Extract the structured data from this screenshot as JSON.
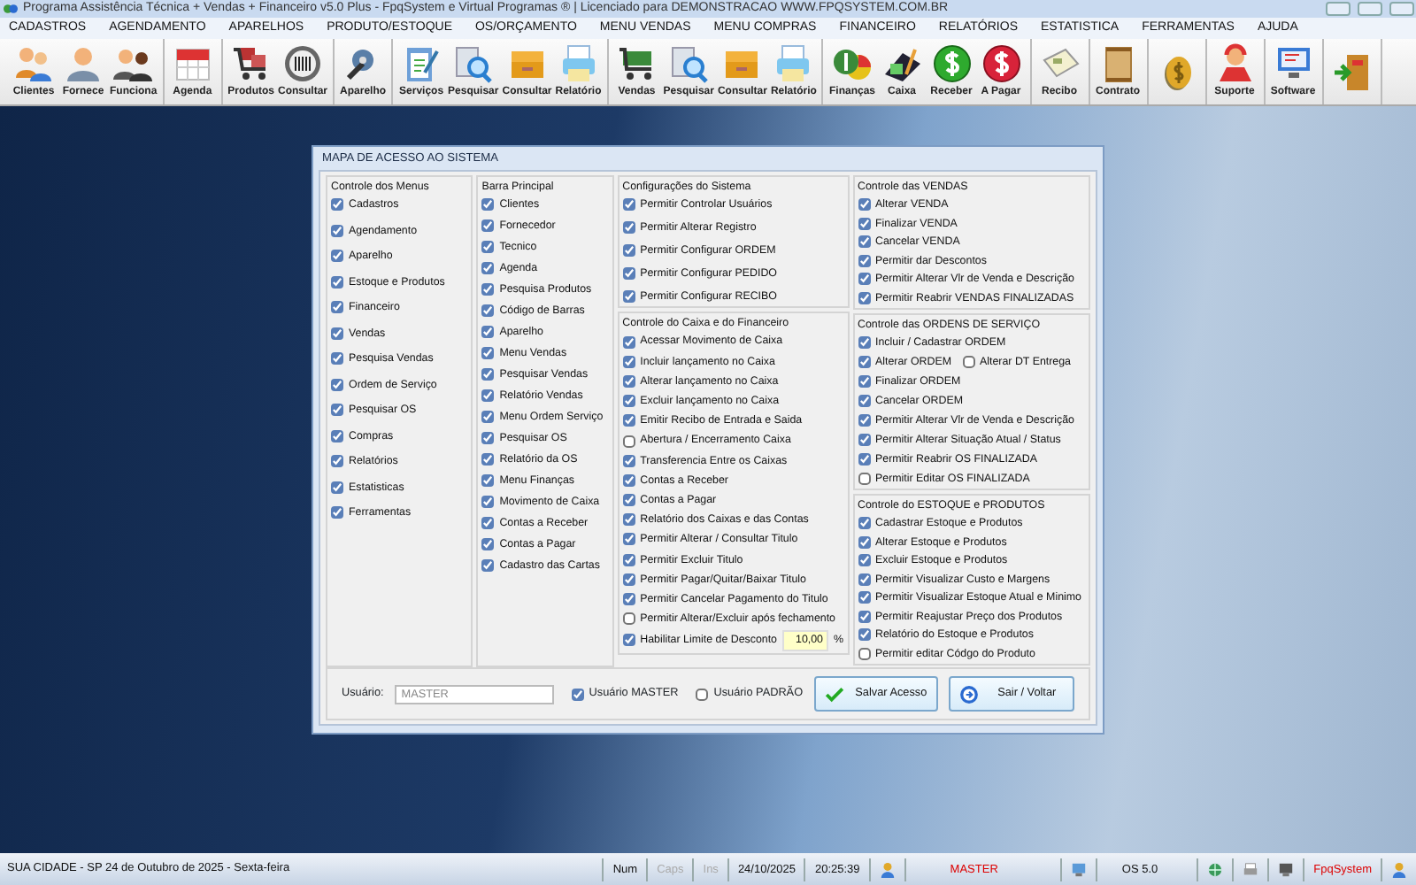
{
  "window": {
    "title": "Programa Assistência Técnica + Vendas + Financeiro v5.0 Plus - FpqSystem e Virtual Programas ® | Licenciado para  DEMONSTRACAO WWW.FPQSYSTEM.COM.BR"
  },
  "menu": [
    "CADASTROS",
    "AGENDAMENTO",
    "APARELHOS",
    "PRODUTO/ESTOQUE",
    "OS/ORÇAMENTO",
    "MENU VENDAS",
    "MENU COMPRAS",
    "FINANCEIRO",
    "RELATÓRIOS",
    "ESTATISTICA",
    "FERRAMENTAS",
    "AJUDA"
  ],
  "toolbar": [
    {
      "kind": "labeled",
      "labels": [
        "Clientes",
        "Fornece",
        "Funciona"
      ]
    },
    {
      "kind": "labeled",
      "labels": [
        "Agenda"
      ]
    },
    {
      "kind": "labeled",
      "labels": [
        "Produtos",
        "Consultar"
      ]
    },
    {
      "kind": "labeled",
      "labels": [
        "Aparelho"
      ]
    },
    {
      "kind": "labeled",
      "labels": [
        "Serviços",
        "Pesquisar",
        "Consultar",
        "Relatório"
      ]
    },
    {
      "kind": "labeled",
      "labels": [
        "Vendas",
        "Pesquisar",
        "Consultar",
        "Relatório"
      ]
    },
    {
      "kind": "labeled",
      "labels": [
        "Finanças",
        "Caixa",
        "Receber",
        "A Pagar"
      ]
    },
    {
      "kind": "labeled",
      "labels": [
        "Recibo"
      ]
    },
    {
      "kind": "labeled",
      "labels": [
        "Contrato"
      ]
    },
    {
      "kind": "icon"
    },
    {
      "kind": "labeled",
      "labels": [
        "Suporte"
      ]
    },
    {
      "kind": "labeled",
      "labels": [
        "Software"
      ]
    },
    {
      "kind": "icon"
    }
  ],
  "dialog": {
    "title": "MAPA DE ACESSO AO SISTEMA",
    "columns": [
      [
        {
          "title": "Controle dos Menus",
          "items": [
            {
              "label": "Cadastros",
              "checked": true
            },
            {
              "label": "Agendamento",
              "checked": true
            },
            {
              "label": "Aparelho",
              "checked": true
            },
            {
              "label": "Estoque e Produtos",
              "checked": true
            },
            {
              "label": "Financeiro",
              "checked": true
            },
            {
              "label": "Vendas",
              "checked": true
            },
            {
              "label": "Pesquisa Vendas",
              "checked": true
            },
            {
              "label": "Ordem de Serviço",
              "checked": true
            },
            {
              "label": "Pesquisar OS",
              "checked": true
            },
            {
              "label": "Compras",
              "checked": true
            },
            {
              "label": "Relatórios",
              "checked": true
            },
            {
              "label": "Estatisticas",
              "checked": true
            },
            {
              "label": "Ferramentas",
              "checked": true
            }
          ]
        }
      ],
      [
        {
          "title": "Barra Principal",
          "items": [
            {
              "label": "Clientes",
              "checked": true
            },
            {
              "label": "Fornecedor",
              "checked": true
            },
            {
              "label": "Tecnico",
              "checked": true
            },
            {
              "label": "Agenda",
              "checked": true
            },
            {
              "label": "Pesquisa Produtos",
              "checked": true
            },
            {
              "label": "Código de Barras",
              "checked": true
            },
            {
              "label": "Aparelho",
              "checked": true
            },
            {
              "label": "Menu Vendas",
              "checked": true
            },
            {
              "label": "Pesquisar Vendas",
              "checked": true
            },
            {
              "label": "Relatório Vendas",
              "checked": true
            },
            {
              "label": "Menu Ordem Serviço",
              "checked": true
            },
            {
              "label": "Pesquisar OS",
              "checked": true
            },
            {
              "label": "Relatório da OS",
              "checked": true
            },
            {
              "label": "Menu Finanças",
              "checked": true
            },
            {
              "label": "Movimento de Caixa",
              "checked": true
            },
            {
              "label": "Contas a Receber",
              "checked": true
            },
            {
              "label": "Contas a Pagar",
              "checked": true
            },
            {
              "label": "Cadastro das Cartas",
              "checked": true
            }
          ]
        }
      ],
      [
        {
          "title": "Configurações do Sistema",
          "items": [
            {
              "label": "Permitir Controlar Usuários",
              "checked": true
            },
            {
              "label": "Permitir Alterar Registro",
              "checked": true
            },
            {
              "label": "Permitir Configurar ORDEM",
              "checked": true
            },
            {
              "label": "Permitir Configurar PEDIDO",
              "checked": true
            },
            {
              "label": "Permitir Configurar RECIBO",
              "checked": true
            }
          ]
        },
        {
          "title": "Controle do Caixa e do Financeiro",
          "items": [
            {
              "label": "Acessar Movimento de Caixa",
              "checked": true
            },
            {
              "label": "Incluir lançamento no Caixa",
              "checked": true
            },
            {
              "label": "Alterar lançamento no Caixa",
              "checked": true
            },
            {
              "label": "Excluir lançamento no Caixa",
              "checked": true
            },
            {
              "label": "Emitir Recibo de Entrada e Saida",
              "checked": true
            },
            {
              "label": "Abertura / Encerramento Caixa",
              "checked": false
            },
            {
              "label": "Transferencia Entre os Caixas",
              "checked": true
            },
            {
              "label": "Contas a Receber",
              "checked": true
            },
            {
              "label": "Contas a Pagar",
              "checked": true
            },
            {
              "label": "Relatório dos Caixas e das Contas",
              "checked": true
            },
            {
              "label": "Permitir Alterar / Consultar Titulo",
              "checked": true
            },
            {
              "label": "Permitir Excluir Titulo",
              "checked": true
            },
            {
              "label": "Permitir Pagar/Quitar/Baixar Titulo",
              "checked": true
            },
            {
              "label": "Permitir Cancelar Pagamento do Titulo",
              "checked": true
            },
            {
              "label": "Permitir Alterar/Excluir após fechamento",
              "checked": false
            },
            {
              "label": "Habilitar Limite de Desconto",
              "checked": true,
              "value": "10,00",
              "unit": "%"
            }
          ]
        }
      ],
      [
        {
          "title": "Controle das VENDAS",
          "items": [
            {
              "label": "Alterar VENDA",
              "checked": true
            },
            {
              "label": "Finalizar VENDA",
              "checked": true
            },
            {
              "label": "Cancelar VENDA",
              "checked": true
            },
            {
              "label": "Permitir dar Descontos",
              "checked": true
            },
            {
              "label": "Permitir Alterar Vlr de Venda e Descrição",
              "checked": true
            },
            {
              "label": "Permitir Reabrir VENDAS FINALIZADAS",
              "checked": true
            }
          ]
        },
        {
          "title": "Controle das ORDENS DE SERVIÇO",
          "items": [
            {
              "label": "Incluir / Cadastrar ORDEM",
              "checked": true
            },
            {
              "label": "Alterar ORDEM",
              "checked": true,
              "side": {
                "label": "Alterar DT Entrega",
                "checked": false
              }
            },
            {
              "label": "Finalizar ORDEM",
              "checked": true
            },
            {
              "label": "Cancelar ORDEM",
              "checked": true
            },
            {
              "label": "Permitir Alterar Vlr de Venda e Descrição",
              "checked": true
            },
            {
              "label": "Permitir Alterar Situação Atual / Status",
              "checked": true
            },
            {
              "label": "Permitir Reabrir OS FINALIZADA",
              "checked": true
            },
            {
              "label": "Permitir Editar OS FINALIZADA",
              "checked": false
            }
          ]
        },
        {
          "title": "Controle do ESTOQUE e PRODUTOS",
          "items": [
            {
              "label": "Cadastrar Estoque e Produtos",
              "checked": true
            },
            {
              "label": "Alterar Estoque e Produtos",
              "checked": true
            },
            {
              "label": "Excluir Estoque e Produtos",
              "checked": true
            },
            {
              "label": "Permitir Visualizar Custo e Margens",
              "checked": true
            },
            {
              "label": "Permitir Visualizar Estoque Atual e Minimo",
              "checked": true
            },
            {
              "label": "Permitir Reajustar Preço dos Produtos",
              "checked": true
            },
            {
              "label": "Relatório do Estoque e Produtos",
              "checked": true
            },
            {
              "label": "Permitir editar Códgo do Produto",
              "checked": false
            }
          ]
        }
      ]
    ],
    "footer": {
      "user_label": "Usuário:",
      "user_value": "MASTER",
      "options": [
        {
          "label": "Usuário MASTER",
          "checked": true
        },
        {
          "label": "Usuário PADRÃO",
          "checked": false
        }
      ],
      "buttons": [
        {
          "label": "Salvar Acesso"
        },
        {
          "label": "Sair / Voltar"
        }
      ]
    }
  },
  "status_bar": {
    "location": "SUA CIDADE - SP 24 de Outubro de 2025 - Sexta-feira",
    "keys": [
      {
        "label": "Num",
        "disabled": false
      },
      {
        "label": "Caps",
        "disabled": true
      },
      {
        "label": "Ins",
        "disabled": true
      }
    ],
    "date": "24/10/2025",
    "time": "20:25:39",
    "user": "MASTER",
    "version": "OS 5.0",
    "brand": "FpqSystem"
  }
}
